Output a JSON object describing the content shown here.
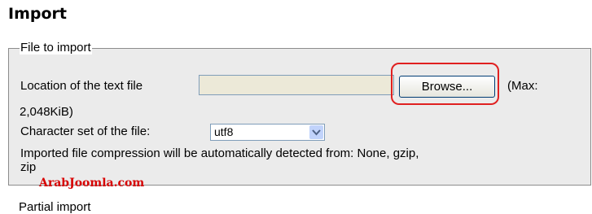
{
  "page": {
    "title": "Import"
  },
  "file_section": {
    "legend": "File to import",
    "location_label": "Location of the text file",
    "browse_label": "Browse...",
    "max_label_part1": "(Max:",
    "max_label_part2": "2,048KiB)",
    "charset_label": "Character set of the file:",
    "charset_value": "utf8",
    "compression_line1": "Imported file compression will be automatically detected from: None, gzip,",
    "compression_line2": "zip",
    "highlight_color": "#e02020"
  },
  "watermark": {
    "text": "ArabJoomla.com"
  },
  "partial_section": {
    "legend": "Partial import"
  }
}
